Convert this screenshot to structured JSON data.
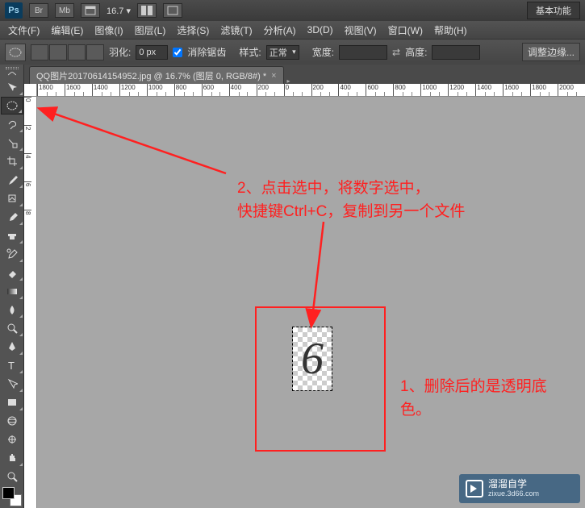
{
  "titlebar": {
    "logo": "Ps",
    "btn_br": "Br",
    "btn_mb": "Mb",
    "zoom": "16.7  ▾",
    "essentials": "基本功能"
  },
  "menu": {
    "file": "文件(F)",
    "edit": "编辑(E)",
    "image": "图像(I)",
    "layer": "图层(L)",
    "select": "选择(S)",
    "filter": "滤镜(T)",
    "analysis": "分析(A)",
    "threeD": "3D(D)",
    "view": "视图(V)",
    "window": "窗口(W)",
    "help": "帮助(H)"
  },
  "options": {
    "feather_label": "羽化:",
    "feather_value": "0 px",
    "antialias": "消除锯齿",
    "style_label": "样式:",
    "style_value": "正常",
    "width_label": "宽度:",
    "height_label": "高度:",
    "refine": "调整边缘..."
  },
  "doc": {
    "tab_title": "QQ图片20170614154952.jpg @ 16.7% (图层 0, RGB/8#) *"
  },
  "ruler_h": [
    "1800",
    "1600",
    "1400",
    "1200",
    "1000",
    "800",
    "600",
    "400",
    "200",
    "0",
    "200",
    "400",
    "600",
    "800",
    "1000",
    "1200",
    "1400",
    "1600",
    "1800",
    "2000"
  ],
  "ruler_v": [
    "0",
    "2",
    "4",
    "6",
    "8"
  ],
  "canvas": {
    "glyph": "6"
  },
  "annotations": {
    "step2": "2、点击选中，将数字选中，\n快捷键Ctrl+C，复制到另一个文件",
    "step1": "1、删除后的是透明底色。"
  },
  "watermark": {
    "brand": "溜溜自学",
    "url": "zixue.3d66.com"
  },
  "colors": {
    "annotation": "#ff2020"
  }
}
